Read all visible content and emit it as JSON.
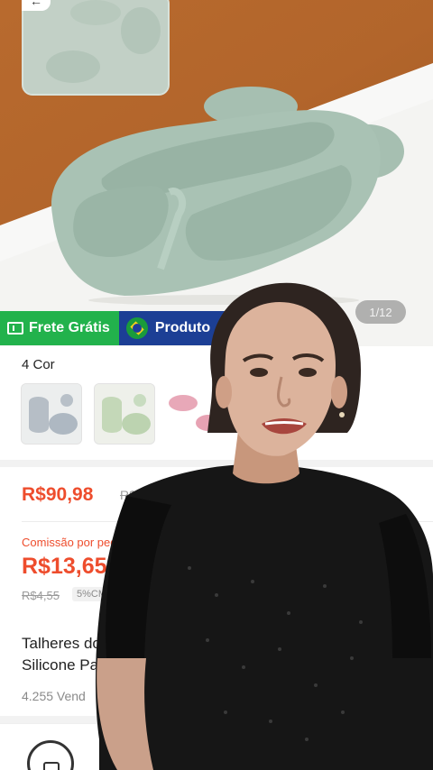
{
  "image_gallery": {
    "counter": "1/12",
    "close_glyph": "←"
  },
  "badges": {
    "free_shipping": "Frete Grátis",
    "national_product": "Produto"
  },
  "colors": {
    "label": "4 Cor",
    "swatch_tints": [
      "#b8c0c8",
      "#c8dcc0",
      "#e8a8b8"
    ]
  },
  "price": {
    "current": "R$90,98",
    "original": "R$15"
  },
  "commission": {
    "label": "Comissão por ped",
    "value": "R$13,65",
    "old_value": "R$4,55",
    "rate": "5%CM"
  },
  "product_title": {
    "line1": "Talheres do",
    "line2": "Silicone Pa",
    "sold": "4.255 Vend"
  },
  "theme": {
    "accent": "#ee4d2d",
    "green_badge": "#22b24c",
    "blue_badge": "#1c3f95",
    "plate": "#a9c2b4"
  }
}
